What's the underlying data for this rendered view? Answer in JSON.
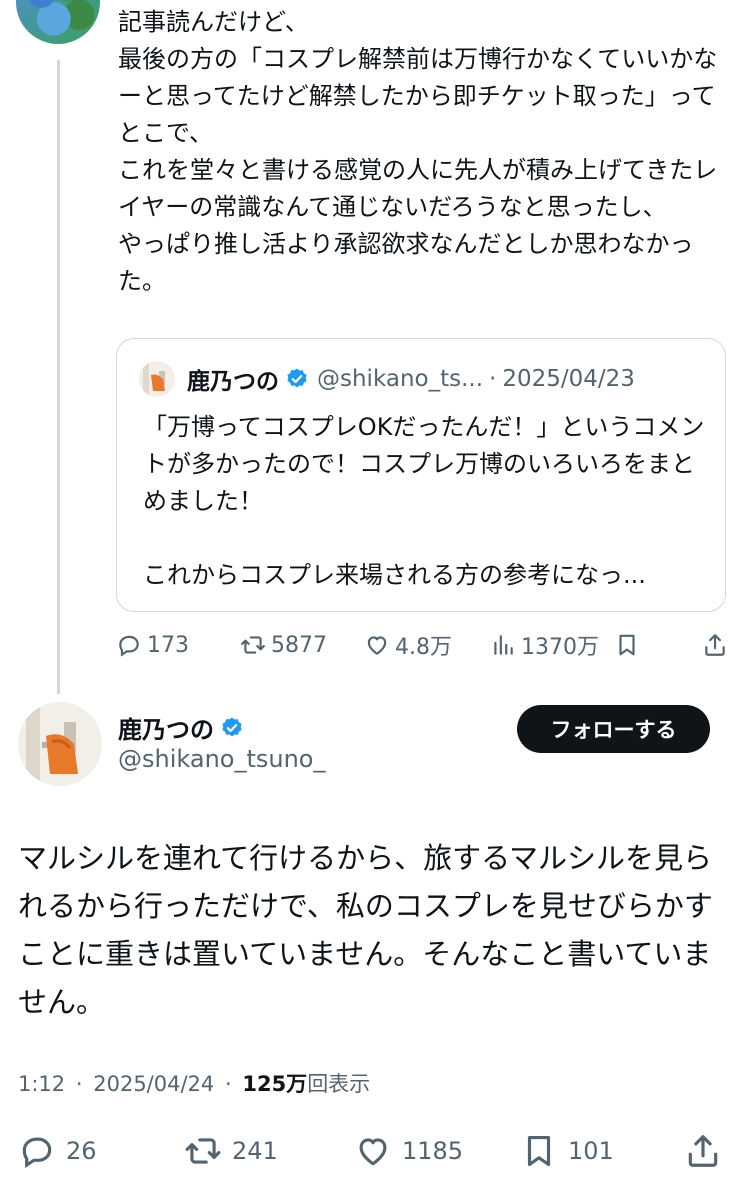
{
  "reply": {
    "body": "記事読んだけど、\n最後の方の「コスプレ解禁前は万博行かなくていいかなーと思ってたけど解禁したから即チケット取った」ってとこで、\nこれを堂々と書ける感覚の人に先人が積み上げてきたレイヤーの常識なんて通じないだろうなと思ったし、\nやっぱり推し活より承認欲求なんだとしか思わなかった。"
  },
  "quote": {
    "name": "鹿乃つの",
    "handle": "@shikano_ts...",
    "separator": "·",
    "date": "2025/04/23",
    "body": "「万博ってコスプレOKだったんだ！」というコメントが多かったので！コスプレ万博のいろいろをまとめました！\n\nこれからコスプレ来場される方の参考になっ..."
  },
  "reply_stats": {
    "replies": "173",
    "reposts": "5877",
    "likes": "4.8万",
    "views": "1370万"
  },
  "main_tweet": {
    "name": "鹿乃つの",
    "handle": "@shikano_tsuno_",
    "follow_label": "フォローする",
    "body": "マルシルを連れて行けるから、旅するマルシルを見られるから行っただけで、私のコスプレを見せびらかすことに重きは置いていません。そんなこと書いていません。",
    "time": "1:12",
    "separator": "·",
    "date": "2025/04/24",
    "separator2": "·",
    "views_count": "125万",
    "views_label": "回表示"
  },
  "main_stats": {
    "replies": "26",
    "reposts": "241",
    "likes": "1185",
    "bookmarks": "101"
  },
  "colors": {
    "text": "#0f1419",
    "secondary": "#536471",
    "border": "#cfd9de",
    "verified": "#1d9bf0",
    "follow_bg": "#0f1419"
  },
  "icons": [
    "reply-icon",
    "repost-icon",
    "like-icon",
    "views-icon",
    "bookmark-icon",
    "share-icon",
    "verified-icon"
  ]
}
